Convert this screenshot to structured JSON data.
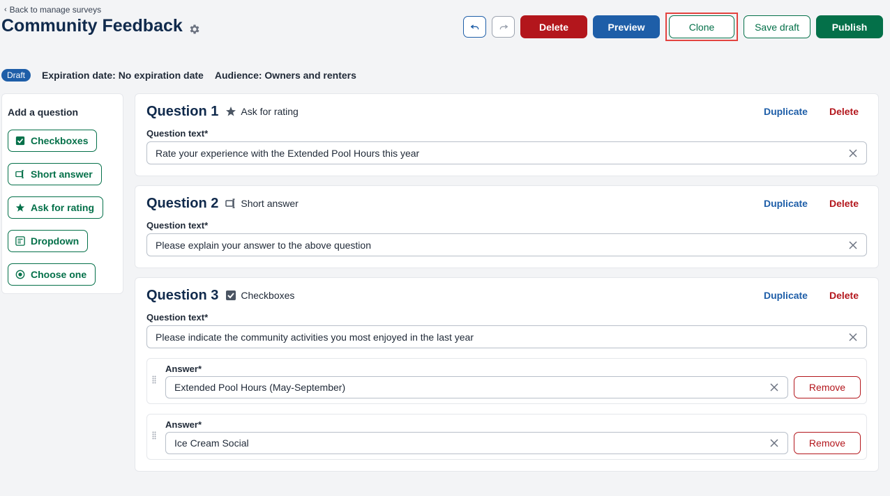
{
  "header": {
    "back_label": "Back to manage surveys",
    "title": "Community Feedback"
  },
  "toolbar": {
    "delete_label": "Delete",
    "preview_label": "Preview",
    "clone_label": "Clone",
    "save_draft_label": "Save draft",
    "publish_label": "Publish"
  },
  "status": {
    "badge": "Draft",
    "expiration": "Expiration date: No expiration date",
    "audience": "Audience: Owners and renters"
  },
  "sidebar": {
    "title": "Add a question",
    "items": [
      {
        "label": "Checkboxes",
        "icon": "checkbox-icon"
      },
      {
        "label": "Short answer",
        "icon": "short-answer-icon"
      },
      {
        "label": "Ask for rating",
        "icon": "star-icon"
      },
      {
        "label": "Dropdown",
        "icon": "dropdown-icon"
      },
      {
        "label": "Choose one",
        "icon": "radio-icon"
      }
    ]
  },
  "questions": [
    {
      "title": "Question 1",
      "type": "Ask for rating",
      "duplicate": "Duplicate",
      "delete": "Delete",
      "text_label": "Question text*",
      "text": "Rate your experience with the Extended Pool Hours this year"
    },
    {
      "title": "Question 2",
      "type": "Short answer",
      "duplicate": "Duplicate",
      "delete": "Delete",
      "text_label": "Question text*",
      "text": "Please explain your answer to the above question"
    },
    {
      "title": "Question 3",
      "type": "Checkboxes",
      "duplicate": "Duplicate",
      "delete": "Delete",
      "text_label": "Question text*",
      "text": "Please indicate the community activities you most enjoyed in the last year",
      "answers": [
        {
          "label": "Answer*",
          "value": "Extended Pool Hours (May-September)",
          "remove": "Remove"
        },
        {
          "label": "Answer*",
          "value": "Ice Cream Social",
          "remove": "Remove"
        }
      ]
    }
  ],
  "colors": {
    "navy": "#102a4c",
    "blue": "#1e5ea8",
    "green": "#047049",
    "red": "#b3161c",
    "highlight": "#e3433f"
  }
}
